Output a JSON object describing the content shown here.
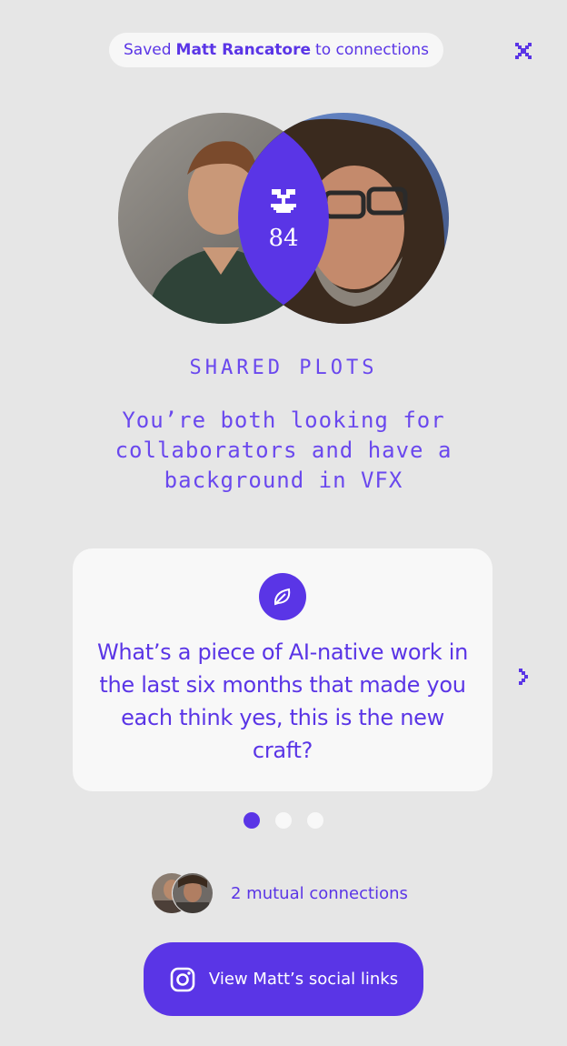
{
  "toast": {
    "prefix": "Saved",
    "name": "Matt Rancatore",
    "suffix": "to connections"
  },
  "venn": {
    "score": "84",
    "icon": "bonsai-icon"
  },
  "shared": {
    "title": "SHARED PLOTS",
    "description": "You’re both looking for collaborators and have a background in VFX"
  },
  "question": {
    "icon": "leaf-icon",
    "text": "What’s a piece of AI-native work in the last six months that made you each think yes, this is the new craft?"
  },
  "carousel": {
    "total": 3,
    "active_index": 0
  },
  "mutual": {
    "text": "2 mutual connections"
  },
  "social_button": {
    "label": "View Matt’s social links",
    "icon": "instagram-icon"
  },
  "colors": {
    "accent": "#5a35e6",
    "background": "#e6e6e6",
    "card": "#f8f8f8"
  }
}
